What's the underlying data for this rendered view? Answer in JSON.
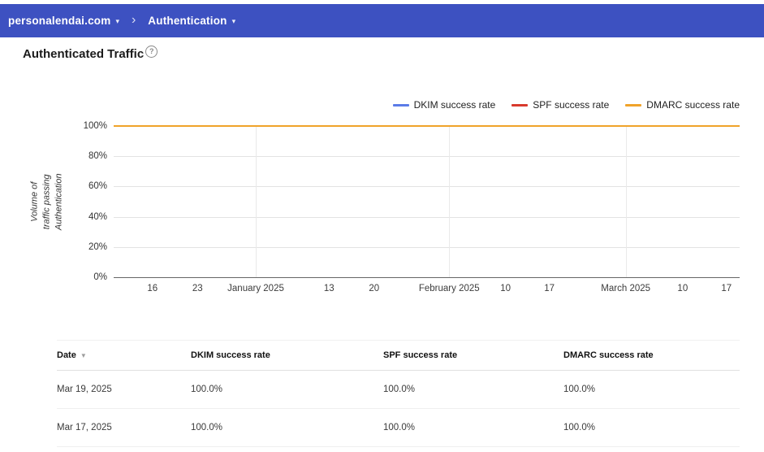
{
  "header": {
    "accent_color": "#3d51c1",
    "domain_menu": {
      "label": "personalendai.com",
      "caret": "▾"
    },
    "separator": "›",
    "section_menu": {
      "label": "Authentication",
      "caret": "▾"
    }
  },
  "page": {
    "title": "Authenticated Traffic",
    "help_icon": "?"
  },
  "chart_data": {
    "type": "line",
    "title": "Authenticated Traffic",
    "ylabel": "Volume of traffic passing Authentication",
    "ylabel_lines": [
      "Volume of traffic passing",
      "Authentication"
    ],
    "ylim": [
      0,
      100
    ],
    "yticks": [
      "0%",
      "20%",
      "40%",
      "60%",
      "80%",
      "100%"
    ],
    "grid": true,
    "legend_position": "top-right",
    "x_ticks": [
      {
        "label": "16",
        "pos": 0.062
      },
      {
        "label": "23",
        "pos": 0.134
      },
      {
        "label": "January 2025",
        "pos": 0.227,
        "major": true
      },
      {
        "label": "13",
        "pos": 0.344
      },
      {
        "label": "20",
        "pos": 0.416
      },
      {
        "label": "February 2025",
        "pos": 0.536,
        "major": true
      },
      {
        "label": "10",
        "pos": 0.626
      },
      {
        "label": "17",
        "pos": 0.696
      },
      {
        "label": "March 2025",
        "pos": 0.818,
        "major": true
      },
      {
        "label": "10",
        "pos": 0.909
      },
      {
        "label": "17",
        "pos": 0.979
      }
    ],
    "series": [
      {
        "name": "DKIM success rate",
        "color": "#5b7ce8",
        "values": [
          100,
          100,
          100,
          100,
          100,
          100,
          100,
          100,
          100,
          100,
          100,
          100,
          100,
          100,
          100
        ]
      },
      {
        "name": "SPF success rate",
        "color": "#d93a2d",
        "values": [
          100,
          100,
          100,
          100,
          100,
          100,
          100,
          100,
          100,
          100,
          100,
          100,
          100,
          100,
          100
        ]
      },
      {
        "name": "DMARC success rate",
        "color": "#f0a32a",
        "values": [
          100,
          100,
          100,
          100,
          100,
          100,
          100,
          100,
          100,
          100,
          100,
          100,
          100,
          100,
          100
        ]
      }
    ]
  },
  "table": {
    "columns": [
      "Date",
      "DKIM success rate",
      "SPF success rate",
      "DMARC success rate"
    ],
    "sort": {
      "column": "Date",
      "direction": "desc",
      "icon": "▼"
    },
    "rows": [
      [
        "Mar 19, 2025",
        "100.0%",
        "100.0%",
        "100.0%"
      ],
      [
        "Mar 17, 2025",
        "100.0%",
        "100.0%",
        "100.0%"
      ]
    ]
  }
}
